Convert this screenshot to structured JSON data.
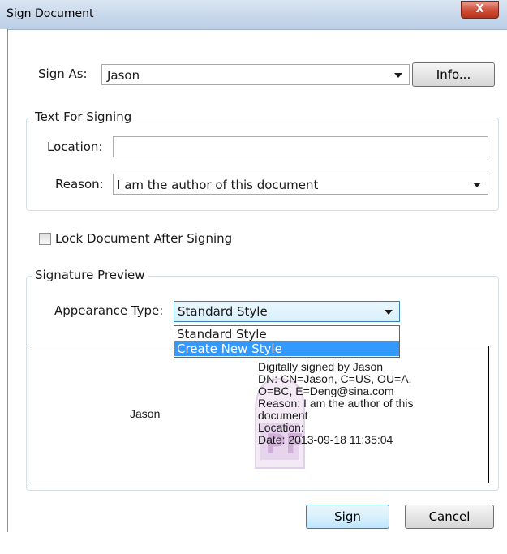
{
  "window": {
    "title": "Sign Document",
    "close_glyph": "X"
  },
  "sign_as": {
    "label": "Sign As:",
    "value": "Jason",
    "info_button": "Info..."
  },
  "text_for_signing": {
    "group_title": "Text For Signing",
    "location_label": "Location:",
    "location_value": "",
    "reason_label": "Reason:",
    "reason_value": "I am the author of this document"
  },
  "lock_document": {
    "label": "Lock Document After Signing",
    "checked": false
  },
  "signature_preview": {
    "group_title": "Signature Preview",
    "appearance_label": "Appearance Type:",
    "appearance_value": "Standard Style",
    "options": [
      "Standard Style",
      "Create New Style"
    ],
    "highlighted_option": "Create New Style",
    "signer_name": "Jason",
    "details": [
      "Digitally signed by Jason",
      "DN: CN=Jason, C=US, OU=A,",
      "O=BC, E=Deng@sina.com",
      "Reason: I am the author of this",
      "document",
      "Location:",
      "Date: 2013-09-18 11:35:04"
    ]
  },
  "footer": {
    "sign_button": "Sign",
    "cancel_button": "Cancel"
  },
  "colors": {
    "titlebar": "#c6d6ea",
    "close": "#c8412b",
    "highlight": "#3399ff",
    "watermark": "#e9dcef"
  }
}
